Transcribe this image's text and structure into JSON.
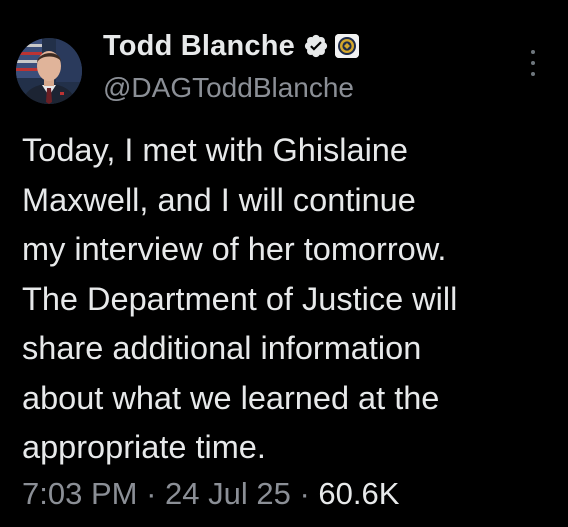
{
  "author": {
    "display_name": "Todd Blanche",
    "handle": "@DAGToddBlanche",
    "avatar_icon": "profile-photo",
    "verified_icon": "verified-badge-icon",
    "affiliate_icon": "doj-seal-icon"
  },
  "tweet": {
    "lines": [
      "Today, I met with Ghislaine",
      "Maxwell, and I will continue",
      "my interview of her tomorrow.",
      "The Department of Justice will",
      "share additional information",
      "about what we learned at the",
      "appropriate time."
    ]
  },
  "meta": {
    "time": "7:03 PM",
    "separator": " · ",
    "date": "24 Jul 25",
    "views": "60.6K"
  },
  "colors": {
    "background": "#000000",
    "text": "#e7e9ea",
    "secondary": "#8b8f96",
    "verified": "#e7e9ea"
  }
}
